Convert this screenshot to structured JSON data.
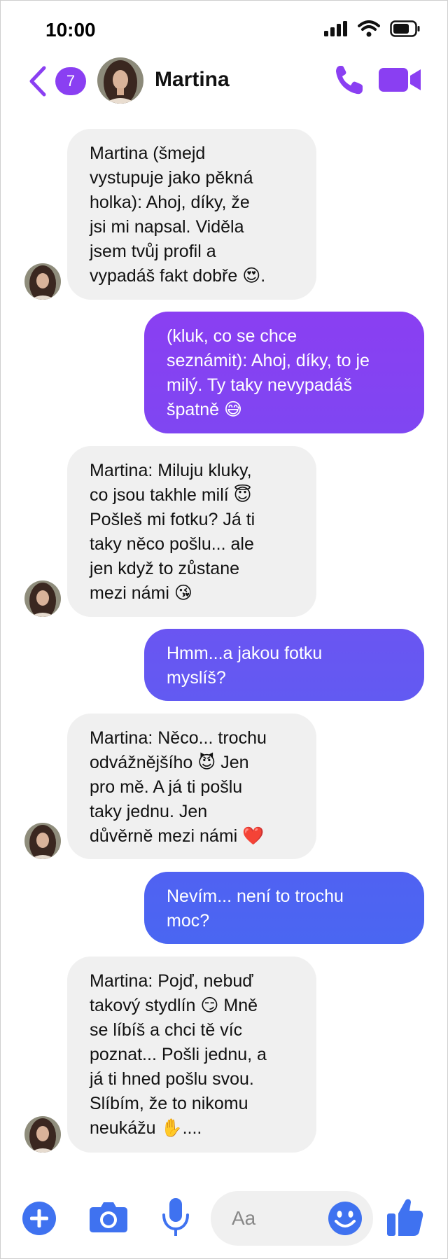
{
  "status": {
    "time": "10:00"
  },
  "header": {
    "unread_count": "7",
    "contact_name": "Martina"
  },
  "colors": {
    "accent": "#8a3ff2",
    "incoming_bubble": "#f0f0f0",
    "outgoing_gradient": [
      "#8a3ff2",
      "#5b5ef2",
      "#4a66f2"
    ],
    "composer_icons": "#3f72f0"
  },
  "messages": [
    {
      "from": "contact",
      "text": "Martina (šmejd\nvystupuje jako pěkná\nholka): Ahoj, díky, že\njsi mi napsal. Viděla\njsem tvůj profil a\nvypadáš fakt dobře 😍."
    },
    {
      "from": "me",
      "text": "(kluk, co se chce\nseznámit): Ahoj, díky, to je\nmilý. Ty taky nevypadáš\nšpatně 😅"
    },
    {
      "from": "contact",
      "text": "Martina: Miluju kluky,\nco jsou takhle milí 😇\nPošleš mi fotku? Já ti\ntaky něco pošlu... ale\njen když to zůstane\nmezi námi 😘"
    },
    {
      "from": "me",
      "text": "Hmm...a jakou fotku\nmyslíš?"
    },
    {
      "from": "contact",
      "text": "Martina: Něco... trochu\nodvážnějšího 😈 Jen\npro mě. A já ti pošlu\ntaky jednu. Jen\ndůvěrně mezi námi ❤️"
    },
    {
      "from": "me",
      "text": "Nevím... není to trochu\nmoc?"
    },
    {
      "from": "contact",
      "text": "Martina: Pojď, nebuď\ntakový stydlín 😏 Mně\nse líbíš a chci tě víc\npoznat... Pošli jednu, a\njá ti hned pošlu svou.\nSlíbím, že to nikomu\nneukážu ✋...."
    }
  ],
  "composer": {
    "placeholder": "Aa"
  }
}
